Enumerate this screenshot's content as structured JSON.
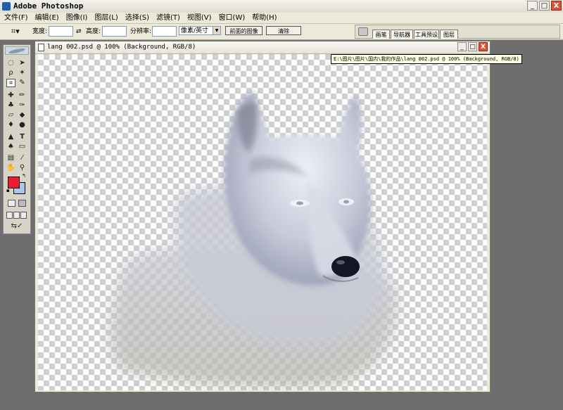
{
  "app": {
    "title": "Adobe Photoshop"
  },
  "window_controls": {
    "minimize": "_",
    "maximize": "□",
    "close": "X"
  },
  "menubar": {
    "items": [
      "文件(F)",
      "编辑(E)",
      "图像(I)",
      "图层(L)",
      "选择(S)",
      "滤镜(T)",
      "视图(V)",
      "窗口(W)",
      "帮助(H)"
    ]
  },
  "options_bar": {
    "width_label": "宽度:",
    "width_value": "",
    "height_label": "高度:",
    "height_value": "",
    "resolution_label": "分辨率:",
    "resolution_value": "",
    "unit_select": "像素/英寸",
    "front_image_button": "前面的图像",
    "clear_button": "清除",
    "dock_tabs": [
      "画笔",
      "导航器",
      "工具预设",
      "图层"
    ]
  },
  "document": {
    "title": "lang 002.psd @ 100% (Background, RGB/8)",
    "tooltip": "E:\\图片\\图片\\国内\\我的作品\\lang 002.psd @ 100% (Background, RGB/8)"
  },
  "colors": {
    "foreground": "#ed1c2e",
    "background": "#a8c8e8",
    "workspace": "#6e6e6e"
  },
  "tools": [
    "marquee-icon",
    "move-icon",
    "lasso-icon",
    "magic-wand-icon",
    "crop-icon",
    "slice-icon",
    "healing-brush-icon",
    "brush-icon",
    "clone-stamp-icon",
    "history-brush-icon",
    "eraser-icon",
    "paint-bucket-icon",
    "blur-icon",
    "dodge-icon",
    "path-selection-icon",
    "type-icon",
    "pen-icon",
    "shape-icon",
    "notes-icon",
    "eyedropper-icon",
    "hand-icon",
    "zoom-icon"
  ]
}
